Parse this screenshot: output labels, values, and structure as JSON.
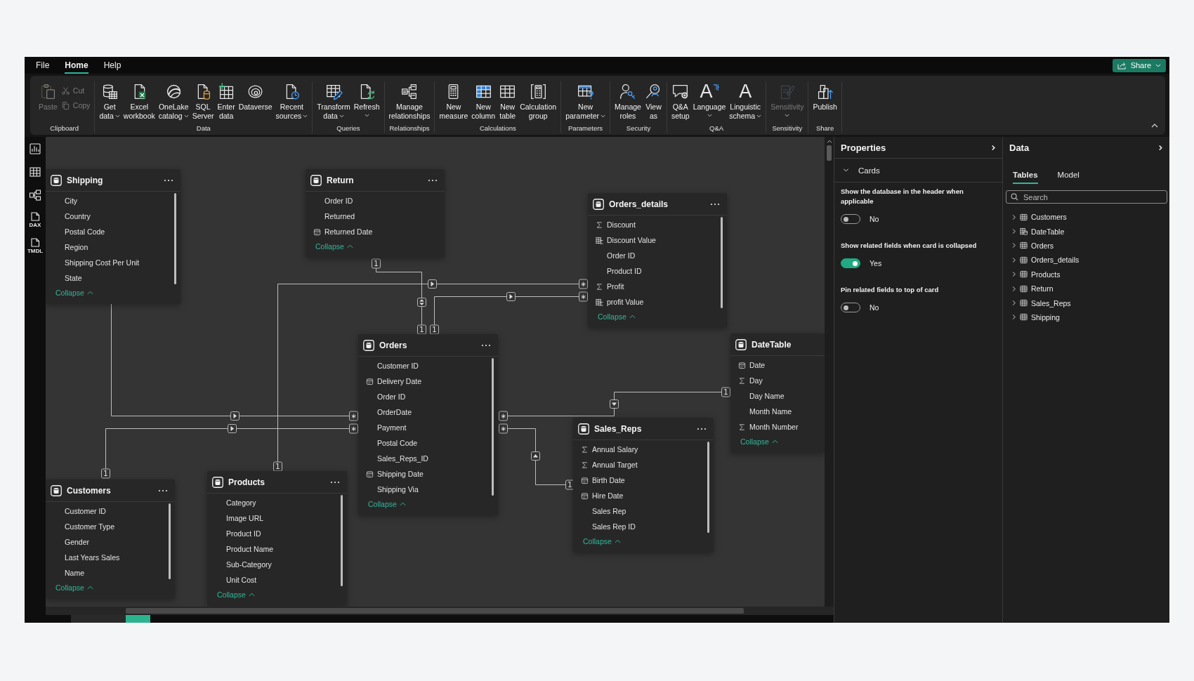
{
  "menu": {
    "tabs": [
      {
        "label": "File",
        "selected": false
      },
      {
        "label": "Home",
        "selected": true
      },
      {
        "label": "Help",
        "selected": false
      }
    ],
    "share": {
      "label": "Share",
      "dropdown": true
    }
  },
  "ribbon": {
    "groups": [
      {
        "label": "Clipboard",
        "buttons": [
          {
            "kind": "large",
            "lines": [
              "Paste"
            ],
            "dropdown": false,
            "disabled": true
          },
          {
            "kind": "small",
            "lines": [
              "Cut"
            ],
            "dropdown": false,
            "disabled": true
          },
          {
            "kind": "small",
            "lines": [
              "Copy"
            ],
            "dropdown": false,
            "disabled": true
          }
        ]
      },
      {
        "label": "Data",
        "buttons": [
          {
            "kind": "large",
            "lines": [
              "Get",
              "data"
            ],
            "dropdown": true,
            "disabled": false
          },
          {
            "kind": "large",
            "lines": [
              "Excel",
              "workbook"
            ],
            "dropdown": false,
            "disabled": false
          },
          {
            "kind": "large",
            "lines": [
              "OneLake",
              "catalog"
            ],
            "dropdown": true,
            "disabled": false
          },
          {
            "kind": "large",
            "lines": [
              "SQL",
              "Server"
            ],
            "dropdown": false,
            "disabled": false
          },
          {
            "kind": "large",
            "lines": [
              "Enter",
              "data"
            ],
            "dropdown": false,
            "disabled": false
          },
          {
            "kind": "large",
            "lines": [
              "Dataverse"
            ],
            "dropdown": false,
            "disabled": false
          },
          {
            "kind": "large",
            "lines": [
              "Recent",
              "sources"
            ],
            "dropdown": true,
            "disabled": false
          }
        ]
      },
      {
        "label": "Queries",
        "buttons": [
          {
            "kind": "large",
            "lines": [
              "Transform",
              "data"
            ],
            "dropdown": true,
            "disabled": false
          },
          {
            "kind": "large",
            "lines": [
              "Refresh"
            ],
            "dropdown": true,
            "disabled": false
          }
        ]
      },
      {
        "label": "Relationships",
        "buttons": [
          {
            "kind": "large",
            "lines": [
              "Manage",
              "relationships"
            ],
            "dropdown": false,
            "disabled": false
          }
        ]
      },
      {
        "label": "Calculations",
        "buttons": [
          {
            "kind": "large",
            "lines": [
              "New",
              "measure"
            ],
            "dropdown": false,
            "disabled": false
          },
          {
            "kind": "large",
            "lines": [
              "New",
              "column"
            ],
            "dropdown": false,
            "disabled": false
          },
          {
            "kind": "large",
            "lines": [
              "New",
              "table"
            ],
            "dropdown": false,
            "disabled": false
          },
          {
            "kind": "large",
            "lines": [
              "Calculation",
              "group"
            ],
            "dropdown": false,
            "disabled": false
          }
        ]
      },
      {
        "label": "Parameters",
        "buttons": [
          {
            "kind": "large",
            "lines": [
              "New",
              "parameter"
            ],
            "dropdown": true,
            "disabled": false
          }
        ]
      },
      {
        "label": "Security",
        "buttons": [
          {
            "kind": "large",
            "lines": [
              "Manage",
              "roles"
            ],
            "dropdown": false,
            "disabled": false
          },
          {
            "kind": "large",
            "lines": [
              "View",
              "as"
            ],
            "dropdown": false,
            "disabled": false
          }
        ]
      },
      {
        "label": "Q&A",
        "buttons": [
          {
            "kind": "large",
            "lines": [
              "Q&A",
              "setup"
            ],
            "dropdown": false,
            "disabled": false
          },
          {
            "kind": "large",
            "glyph": "A",
            "lines": [
              "Language"
            ],
            "dropdown": true,
            "disabled": false
          },
          {
            "kind": "large",
            "glyph": "A",
            "lines": [
              "Linguistic",
              "schema"
            ],
            "dropdown": true,
            "disabled": false
          }
        ]
      },
      {
        "label": "Sensitivity",
        "buttons": [
          {
            "kind": "large",
            "lines": [
              "Sensitivity"
            ],
            "dropdown": true,
            "disabled": true
          }
        ]
      },
      {
        "label": "Share",
        "buttons": [
          {
            "kind": "large",
            "lines": [
              "Publish"
            ],
            "dropdown": false,
            "disabled": false
          }
        ]
      }
    ]
  },
  "left_nav": [
    {
      "kind": "report"
    },
    {
      "kind": "table"
    },
    {
      "kind": "model"
    },
    {
      "kind": "dax",
      "label": "DAX"
    },
    {
      "kind": "tmdl",
      "label": "TMDL"
    }
  ],
  "model_canvas": {
    "tables": [
      {
        "name": "Shipping",
        "scrollable": true,
        "fields": [
          {
            "name": "City",
            "kind": "text"
          },
          {
            "name": "Country",
            "kind": "text"
          },
          {
            "name": "Postal Code",
            "kind": "text"
          },
          {
            "name": "Region",
            "kind": "text"
          },
          {
            "name": "Shipping Cost Per Unit",
            "kind": "text"
          },
          {
            "name": "State",
            "kind": "text"
          }
        ],
        "collapse_label": "Collapse"
      },
      {
        "name": "Return",
        "scrollable": false,
        "fields": [
          {
            "name": "Order ID",
            "kind": "text"
          },
          {
            "name": "Returned",
            "kind": "text"
          },
          {
            "name": "Returned Date",
            "kind": "date"
          }
        ],
        "collapse_label": "Collapse"
      },
      {
        "name": "Orders_details",
        "scrollable": true,
        "fields": [
          {
            "name": "Discount",
            "kind": "sum"
          },
          {
            "name": "Discount Value",
            "kind": "calculated"
          },
          {
            "name": "Order ID",
            "kind": "text"
          },
          {
            "name": "Product ID",
            "kind": "text"
          },
          {
            "name": "Profit",
            "kind": "sum"
          },
          {
            "name": "profit Value",
            "kind": "calculated"
          }
        ],
        "collapse_label": "Collapse"
      },
      {
        "name": "Orders",
        "scrollable": true,
        "fields": [
          {
            "name": "Customer ID",
            "kind": "text"
          },
          {
            "name": "Delivery Date",
            "kind": "date"
          },
          {
            "name": "Order ID",
            "kind": "text"
          },
          {
            "name": "OrderDate",
            "kind": "text"
          },
          {
            "name": "Payment",
            "kind": "text"
          },
          {
            "name": "Postal Code",
            "kind": "text"
          },
          {
            "name": "Sales_Reps_ID",
            "kind": "text"
          },
          {
            "name": "Shipping Date",
            "kind": "date"
          },
          {
            "name": "Shipping Via",
            "kind": "text"
          }
        ],
        "collapse_label": "Collapse"
      },
      {
        "name": "DateTable",
        "scrollable": false,
        "fields": [
          {
            "name": "Date",
            "kind": "date"
          },
          {
            "name": "Day",
            "kind": "sum"
          },
          {
            "name": "Day Name",
            "kind": "text"
          },
          {
            "name": "Month Name",
            "kind": "text"
          },
          {
            "name": "Month Number",
            "kind": "sum"
          }
        ],
        "collapse_label": "Collapse"
      },
      {
        "name": "Sales_Reps",
        "scrollable": true,
        "fields": [
          {
            "name": "Annual Salary",
            "kind": "sum"
          },
          {
            "name": "Annual Target",
            "kind": "sum"
          },
          {
            "name": "Birth Date",
            "kind": "date"
          },
          {
            "name": "Hire Date",
            "kind": "date"
          },
          {
            "name": "Sales Rep",
            "kind": "text"
          },
          {
            "name": "Sales Rep ID",
            "kind": "text"
          }
        ],
        "collapse_label": "Collapse"
      },
      {
        "name": "Customers",
        "scrollable": true,
        "fields": [
          {
            "name": "Customer ID",
            "kind": "text"
          },
          {
            "name": "Customer Type",
            "kind": "text"
          },
          {
            "name": "Gender",
            "kind": "text"
          },
          {
            "name": "Last Years Sales",
            "kind": "text"
          },
          {
            "name": "Name",
            "kind": "text"
          }
        ],
        "collapse_label": "Collapse"
      },
      {
        "name": "Products",
        "scrollable": true,
        "fields": [
          {
            "name": "Category",
            "kind": "text"
          },
          {
            "name": "Image URL",
            "kind": "text"
          },
          {
            "name": "Product ID",
            "kind": "text"
          },
          {
            "name": "Product Name",
            "kind": "text"
          },
          {
            "name": "Sub-Category",
            "kind": "text"
          },
          {
            "name": "Unit Cost",
            "kind": "text"
          }
        ],
        "collapse_label": "Collapse"
      }
    ],
    "relationships": [
      {
        "start_mark": "1",
        "end_mark": "1",
        "bidirectional": true
      },
      {
        "start_mark": "1",
        "end_mark": "∗",
        "bidirectional": false
      },
      {
        "start_mark": "1",
        "end_mark": "∗",
        "bidirectional": false
      },
      {
        "end_mark": "∗",
        "bidirectional": false
      },
      {
        "start_mark": "1",
        "end_mark": "∗",
        "bidirectional": false
      },
      {
        "start_mark": "∗",
        "end_mark": "1",
        "bidirectional": false
      },
      {
        "start_mark": "∗",
        "end_mark": "1",
        "bidirectional": false
      }
    ]
  },
  "page_tabs": [
    {
      "selected": false
    },
    {
      "selected": true
    }
  ],
  "properties": {
    "title": "Properties",
    "section": {
      "title": "Cards",
      "expanded": true
    },
    "settings": [
      {
        "label": "Show the database in the header when applicable",
        "on": false,
        "state_text": "No"
      },
      {
        "label": "Show related fields when card is collapsed",
        "on": true,
        "state_text": "Yes"
      },
      {
        "label": "Pin related fields to top of card",
        "on": false,
        "state_text": "No"
      }
    ]
  },
  "data_pane": {
    "title": "Data",
    "tabs": [
      {
        "label": "Tables",
        "selected": true
      },
      {
        "label": "Model",
        "selected": false
      }
    ],
    "search": {
      "placeholder": "Search"
    },
    "tables": [
      {
        "name": "Customers",
        "kind": "table",
        "expanded": false
      },
      {
        "name": "DateTable",
        "kind": "date_table",
        "expanded": false
      },
      {
        "name": "Orders",
        "kind": "table",
        "expanded": false
      },
      {
        "name": "Orders_details",
        "kind": "table",
        "expanded": false
      },
      {
        "name": "Products",
        "kind": "table",
        "expanded": false
      },
      {
        "name": "Return",
        "kind": "table",
        "expanded": false
      },
      {
        "name": "Sales_Reps",
        "kind": "table",
        "expanded": false
      },
      {
        "name": "Shipping",
        "kind": "table",
        "expanded": false
      }
    ]
  }
}
